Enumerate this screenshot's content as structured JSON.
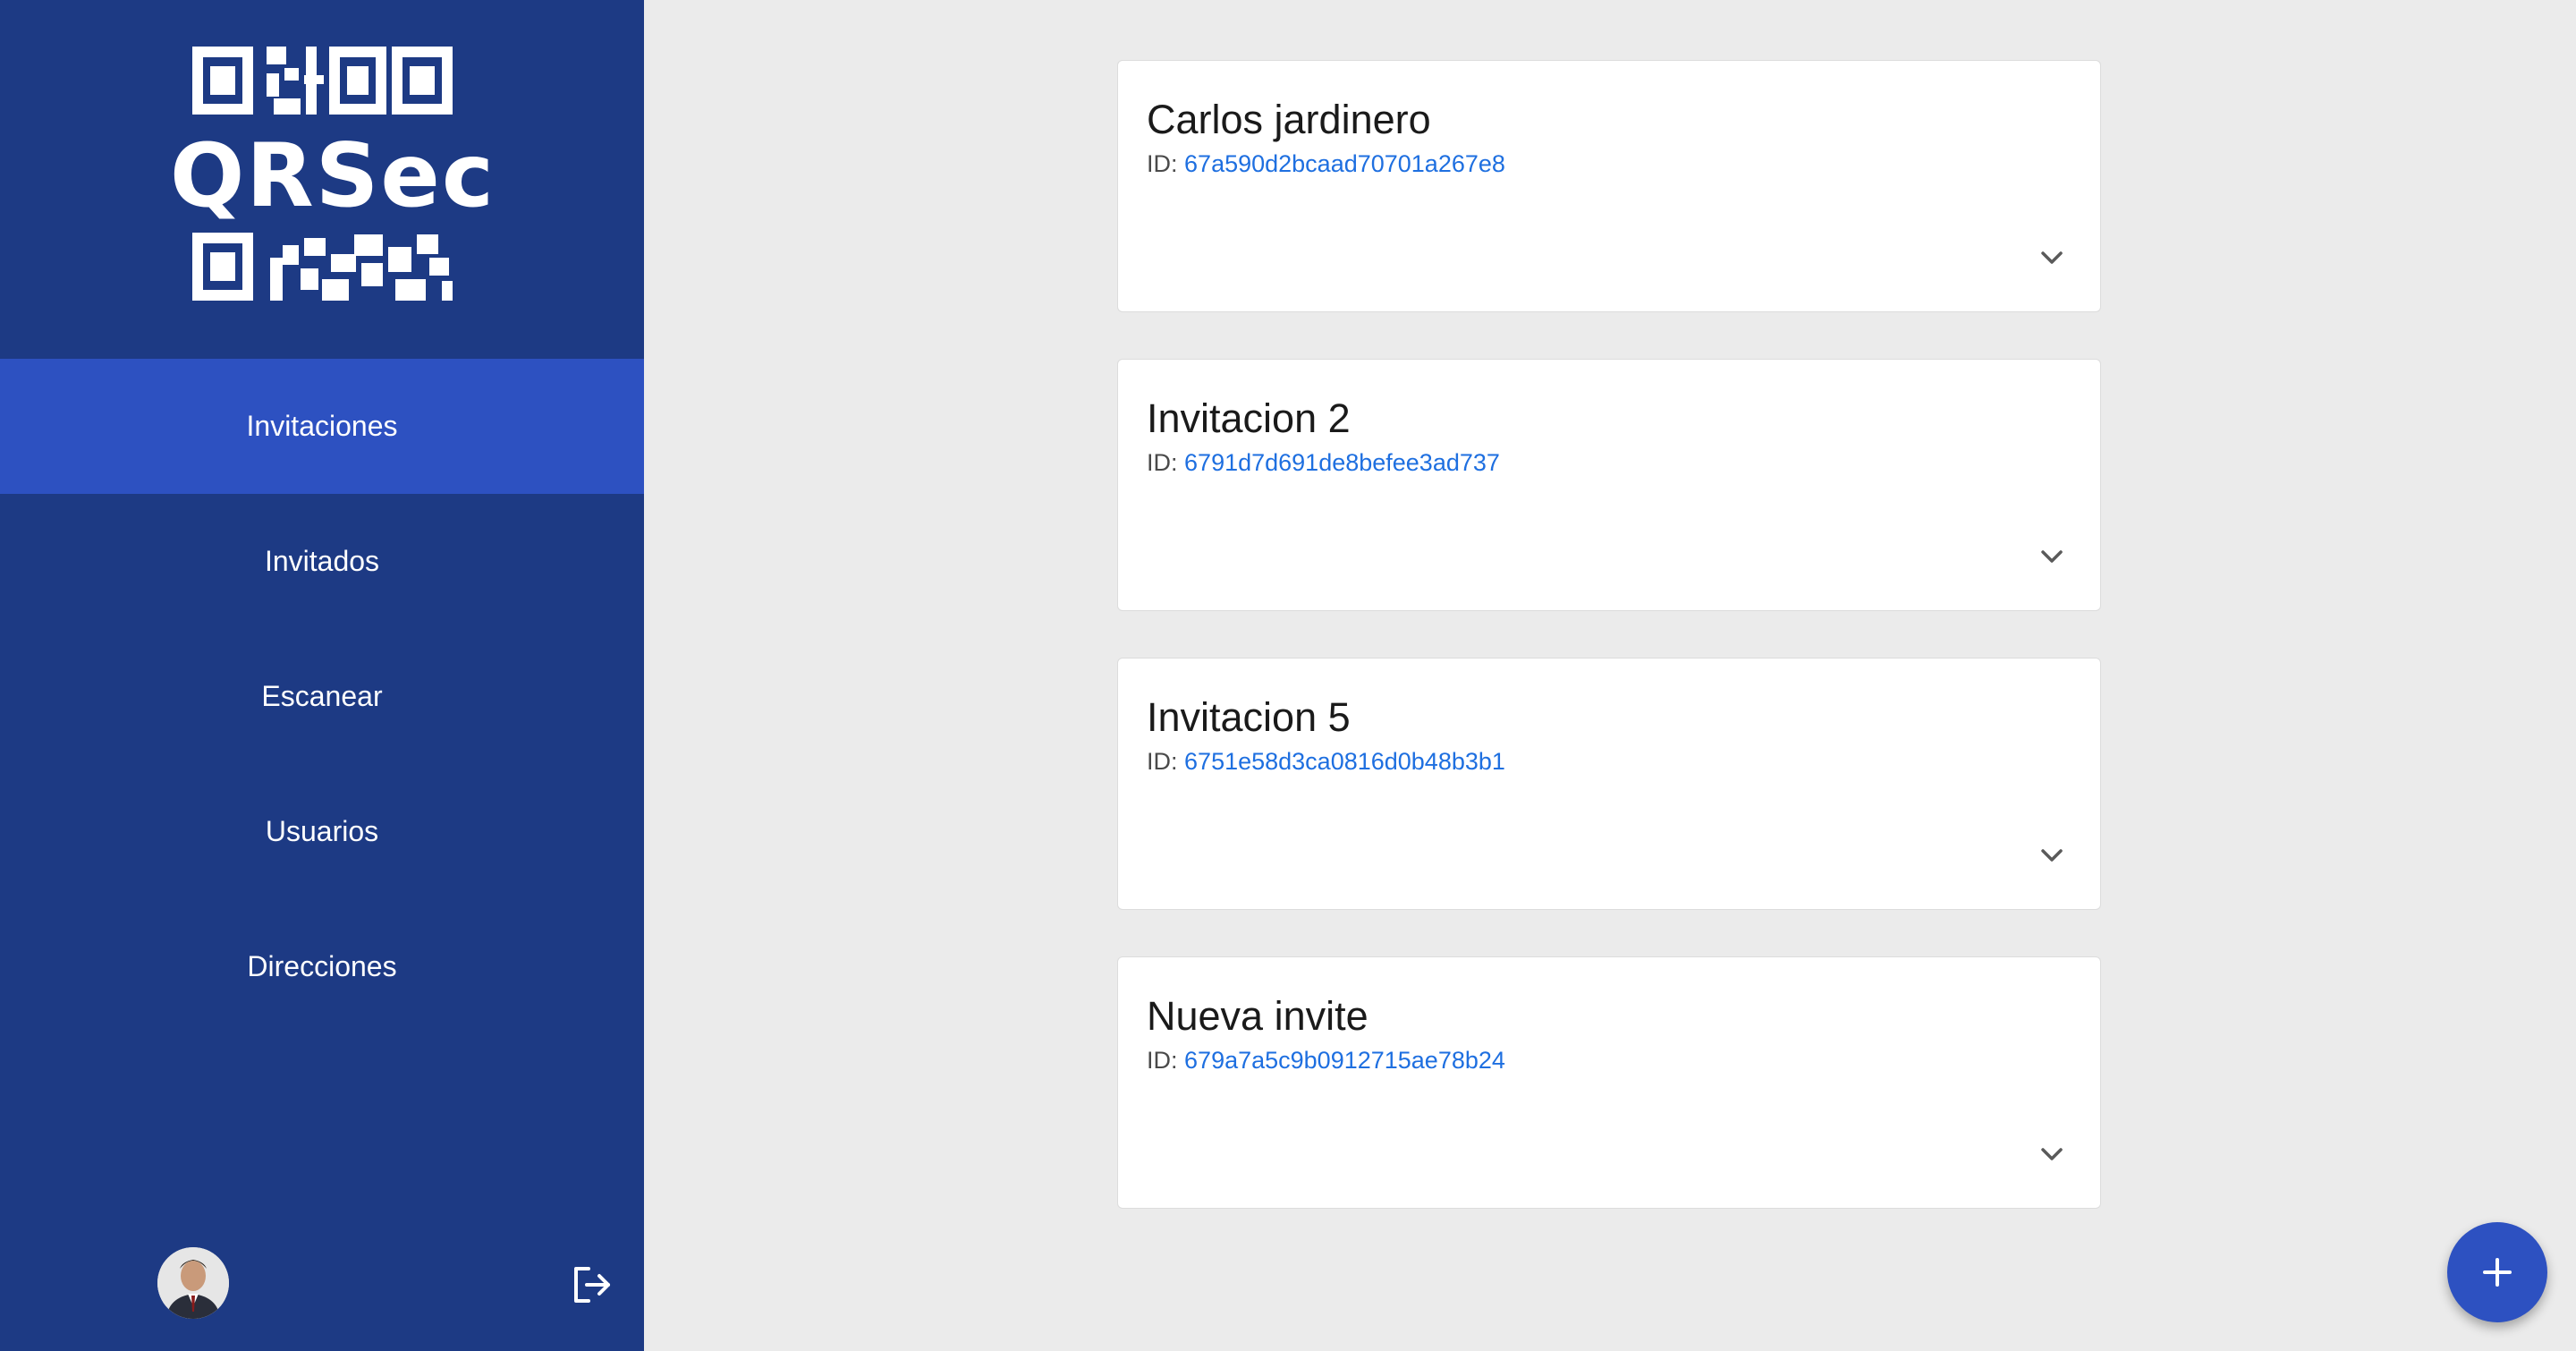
{
  "app": {
    "logo_text": "QRSec"
  },
  "sidebar": {
    "items": [
      {
        "label": "Invitaciones",
        "active": true
      },
      {
        "label": "Invitados"
      },
      {
        "label": "Escanear"
      },
      {
        "label": "Usuarios"
      },
      {
        "label": "Direcciones"
      }
    ],
    "logout_icon": "logout-icon",
    "avatar_icon": "user-avatar"
  },
  "invitations": [
    {
      "title": "Carlos jardinero",
      "id_label": "ID:",
      "id": "67a590d2bcaad70701a267e8"
    },
    {
      "title": "Invitacion 2",
      "id_label": "ID:",
      "id": "6791d7d691de8befee3ad737"
    },
    {
      "title": "Invitacion 5",
      "id_label": "ID:",
      "id": "6751e58d3ca0816d0b48b3b1"
    },
    {
      "title": "Nueva invite",
      "id_label": "ID:",
      "id": "679a7a5c9b0912715ae78b24"
    }
  ],
  "fab": {
    "icon": "plus-icon"
  },
  "colors": {
    "sidebar_bg": "#1d3a84",
    "active_item": "#2d51c1",
    "main_bg": "#ebebeb",
    "id_link": "#1e6fe0"
  }
}
